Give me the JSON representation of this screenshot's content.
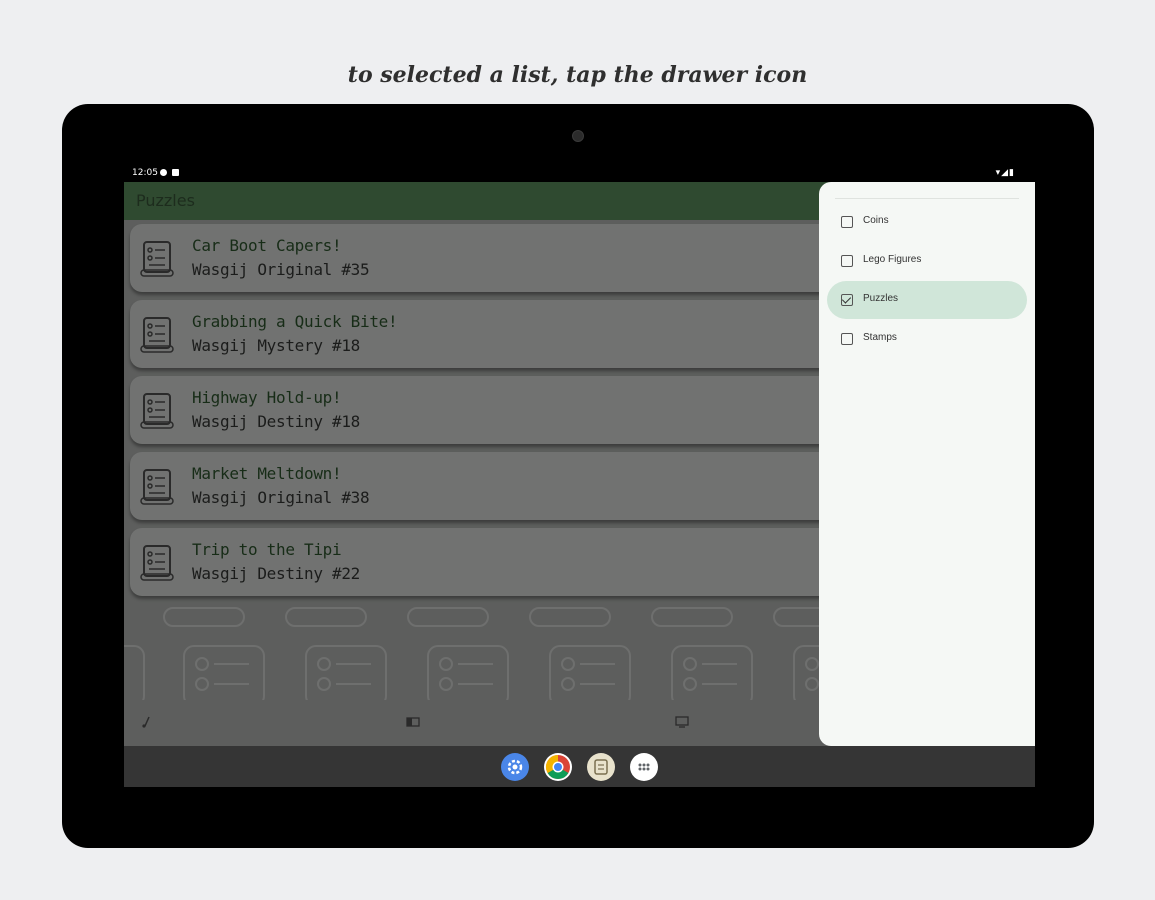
{
  "caption": "to selected a list, tap the drawer icon",
  "status": {
    "time": "12:05"
  },
  "appbar": {
    "title": "Puzzles"
  },
  "items": [
    {
      "title": "Car Boot Capers!",
      "subtitle": "Wasgij Original #35"
    },
    {
      "title": "Grabbing a Quick Bite!",
      "subtitle": "Wasgij Mystery #18"
    },
    {
      "title": "Highway Hold-up!",
      "subtitle": "Wasgij Destiny #18"
    },
    {
      "title": "Market Meltdown!",
      "subtitle": "Wasgij Original #38"
    },
    {
      "title": "Trip to the Tipi",
      "subtitle": "Wasgij Destiny #22"
    }
  ],
  "drawer": {
    "items": [
      {
        "label": "Coins",
        "checked": false,
        "active": false
      },
      {
        "label": "Lego Figures",
        "checked": false,
        "active": false
      },
      {
        "label": "Puzzles",
        "checked": true,
        "active": true
      },
      {
        "label": "Stamps",
        "checked": false,
        "active": false
      }
    ]
  },
  "dock": {
    "icons": [
      "settings-icon",
      "chrome-icon",
      "app-icon",
      "app-drawer-icon"
    ]
  },
  "colors": {
    "appbar": "#2f4a30",
    "drawer_active": "#d0e6d9",
    "title_text": "#172c17"
  }
}
